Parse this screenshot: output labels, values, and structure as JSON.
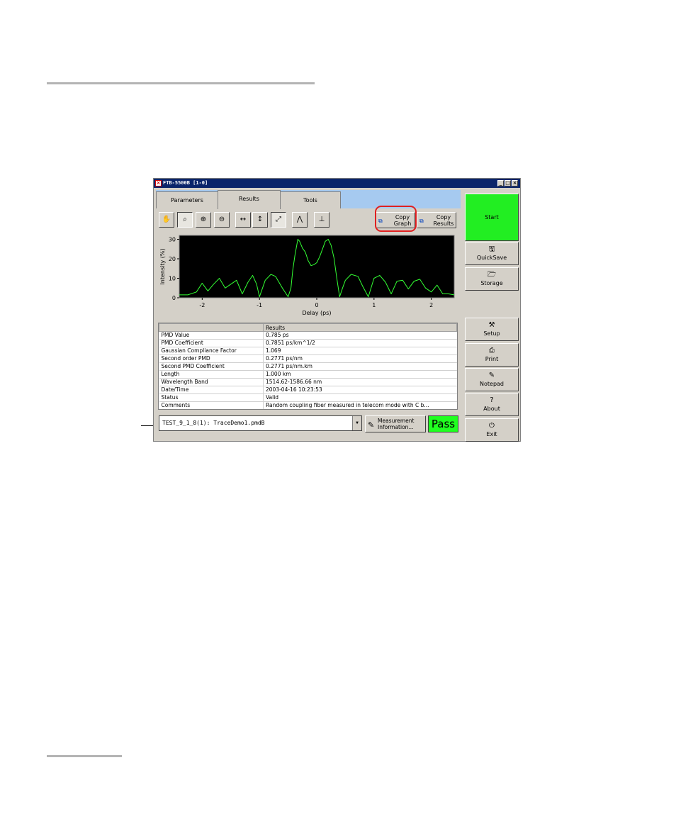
{
  "window": {
    "title": "FTB-5500B [1-0]",
    "controls": {
      "minimize": "_",
      "maximize": "□",
      "close": "×"
    }
  },
  "tabs": [
    {
      "label": "Parameters",
      "active": false
    },
    {
      "label": "Results",
      "active": true
    },
    {
      "label": "Tools",
      "active": false
    }
  ],
  "toolbar": {
    "tools": [
      {
        "name": "pan-tool",
        "icon": "hand-icon",
        "glyph": "✋"
      },
      {
        "name": "zoom-area-tool",
        "icon": "magnifier-area-icon",
        "glyph": "⌕"
      },
      {
        "name": "zoom-in-tool",
        "icon": "zoom-in-icon",
        "glyph": "⊕"
      },
      {
        "name": "zoom-out-tool",
        "icon": "zoom-out-icon",
        "glyph": "⊖"
      },
      {
        "name": "zoom-horizontal-tool",
        "icon": "zoom-horizontal-icon",
        "glyph": "↔"
      },
      {
        "name": "zoom-vertical-tool",
        "icon": "zoom-vertical-icon",
        "glyph": "↕"
      },
      {
        "name": "zoom-both-tool",
        "icon": "zoom-both-icon",
        "glyph": "⤢"
      },
      {
        "name": "full-view-tool",
        "icon": "full-view-icon",
        "glyph": "⋀"
      },
      {
        "name": "marker-tool",
        "icon": "marker-icon",
        "glyph": "⊥"
      }
    ],
    "copy_graph": {
      "line1": "Copy",
      "line2": "Graph"
    },
    "copy_results": {
      "line1": "Copy",
      "line2": "Results"
    }
  },
  "chart_data": {
    "type": "line",
    "xlabel": "Delay (ps)",
    "ylabel": "Intensity (%)",
    "xlim": [
      -2.4,
      2.4
    ],
    "ylim": [
      0,
      32
    ],
    "xticks": [
      -2,
      -1,
      0,
      1,
      2
    ],
    "yticks": [
      0,
      10,
      20,
      30
    ],
    "background": "#000000",
    "line_color": "#33ff33",
    "series": [
      {
        "x": [
          -2.4,
          -2.25,
          -2.1,
          -2.0,
          -1.9,
          -1.8,
          -1.7,
          -1.6,
          -1.5,
          -1.4,
          -1.3,
          -1.2,
          -1.12,
          -1.05,
          -1.0,
          -0.9,
          -0.8,
          -0.72,
          -0.6,
          -0.5,
          -0.45,
          -0.42,
          -0.38,
          -0.33,
          -0.3,
          -0.25,
          -0.2,
          -0.15,
          -0.1,
          -0.05,
          0.0,
          0.05,
          0.1,
          0.15,
          0.2,
          0.25,
          0.3,
          0.35,
          0.4,
          0.45,
          0.5,
          0.6,
          0.72,
          0.8,
          0.9,
          1.0,
          1.1,
          1.2,
          1.3,
          1.4,
          1.5,
          1.6,
          1.7,
          1.8,
          1.9,
          2.0,
          2.1,
          2.2,
          2.3,
          2.4
        ],
        "y": [
          1.5,
          1.5,
          3.0,
          7.5,
          3.5,
          7.0,
          10.0,
          5.0,
          7.0,
          9.0,
          2.0,
          8.0,
          11.5,
          7.0,
          0.5,
          9.0,
          12.0,
          11.0,
          5.0,
          0.5,
          5.0,
          14.0,
          22.0,
          30.0,
          29.0,
          25.5,
          23.5,
          19.0,
          16.5,
          17.0,
          18.0,
          21.0,
          25.0,
          29.0,
          30.0,
          27.0,
          20.5,
          10.0,
          0.5,
          5.0,
          9.0,
          12.0,
          11.0,
          6.0,
          0.5,
          10.0,
          11.5,
          8.0,
          2.0,
          8.5,
          9.0,
          4.5,
          8.5,
          9.5,
          5.0,
          3.0,
          6.5,
          2.0,
          2.0,
          1.5
        ]
      }
    ]
  },
  "results": {
    "header_left": "",
    "header_right": "Results",
    "rows": [
      {
        "label": "PMD Value",
        "value": "0.785 ps"
      },
      {
        "label": "PMD Coefficient",
        "value": "0.7851 ps/km^1/2"
      },
      {
        "label": "Gaussian Compliance Factor",
        "value": "1.069"
      },
      {
        "label": "Second order PMD",
        "value": "0.2771 ps/nm"
      },
      {
        "label": "Second PMD Coefficient",
        "value": "0.2771 ps/nm.km"
      },
      {
        "label": "Length",
        "value": "1.000 km"
      },
      {
        "label": "Wavelength Band",
        "value": "1514.62-1586.66 nm"
      },
      {
        "label": "Date/Time",
        "value": "2003-04-16 10:23:53"
      },
      {
        "label": "Status",
        "value": "Valid"
      },
      {
        "label": "Comments",
        "value": "Random coupling fiber measured in telecom mode with C b..."
      }
    ]
  },
  "bottom": {
    "trace_select": "TEST_9_1_8(1): TraceDemo1.pmdB",
    "measurement_info": {
      "line1": "Measurement",
      "line2": "Information..."
    },
    "status": "Pass",
    "status_color": "#20ff20"
  },
  "side": {
    "start": "Start",
    "start_color": "#22ee22",
    "buttons": [
      {
        "name": "quicksave-button",
        "label": "QuickSave",
        "icon": "floppy-disk-icon",
        "glyph": "🖫"
      },
      {
        "name": "storage-button",
        "label": "Storage",
        "icon": "folder-icon",
        "glyph": "🗁"
      },
      {
        "name": "setup-button",
        "label": "Setup",
        "icon": "tools-icon",
        "glyph": "⚒"
      },
      {
        "name": "print-button",
        "label": "Print",
        "icon": "printer-icon",
        "glyph": "⎙"
      },
      {
        "name": "notepad-button",
        "label": "Notepad",
        "icon": "notepad-icon",
        "glyph": "✎"
      },
      {
        "name": "about-button",
        "label": "About",
        "icon": "about-icon",
        "glyph": "?"
      },
      {
        "name": "exit-button",
        "label": "Exit",
        "icon": "power-icon",
        "glyph": "⏻"
      }
    ]
  }
}
